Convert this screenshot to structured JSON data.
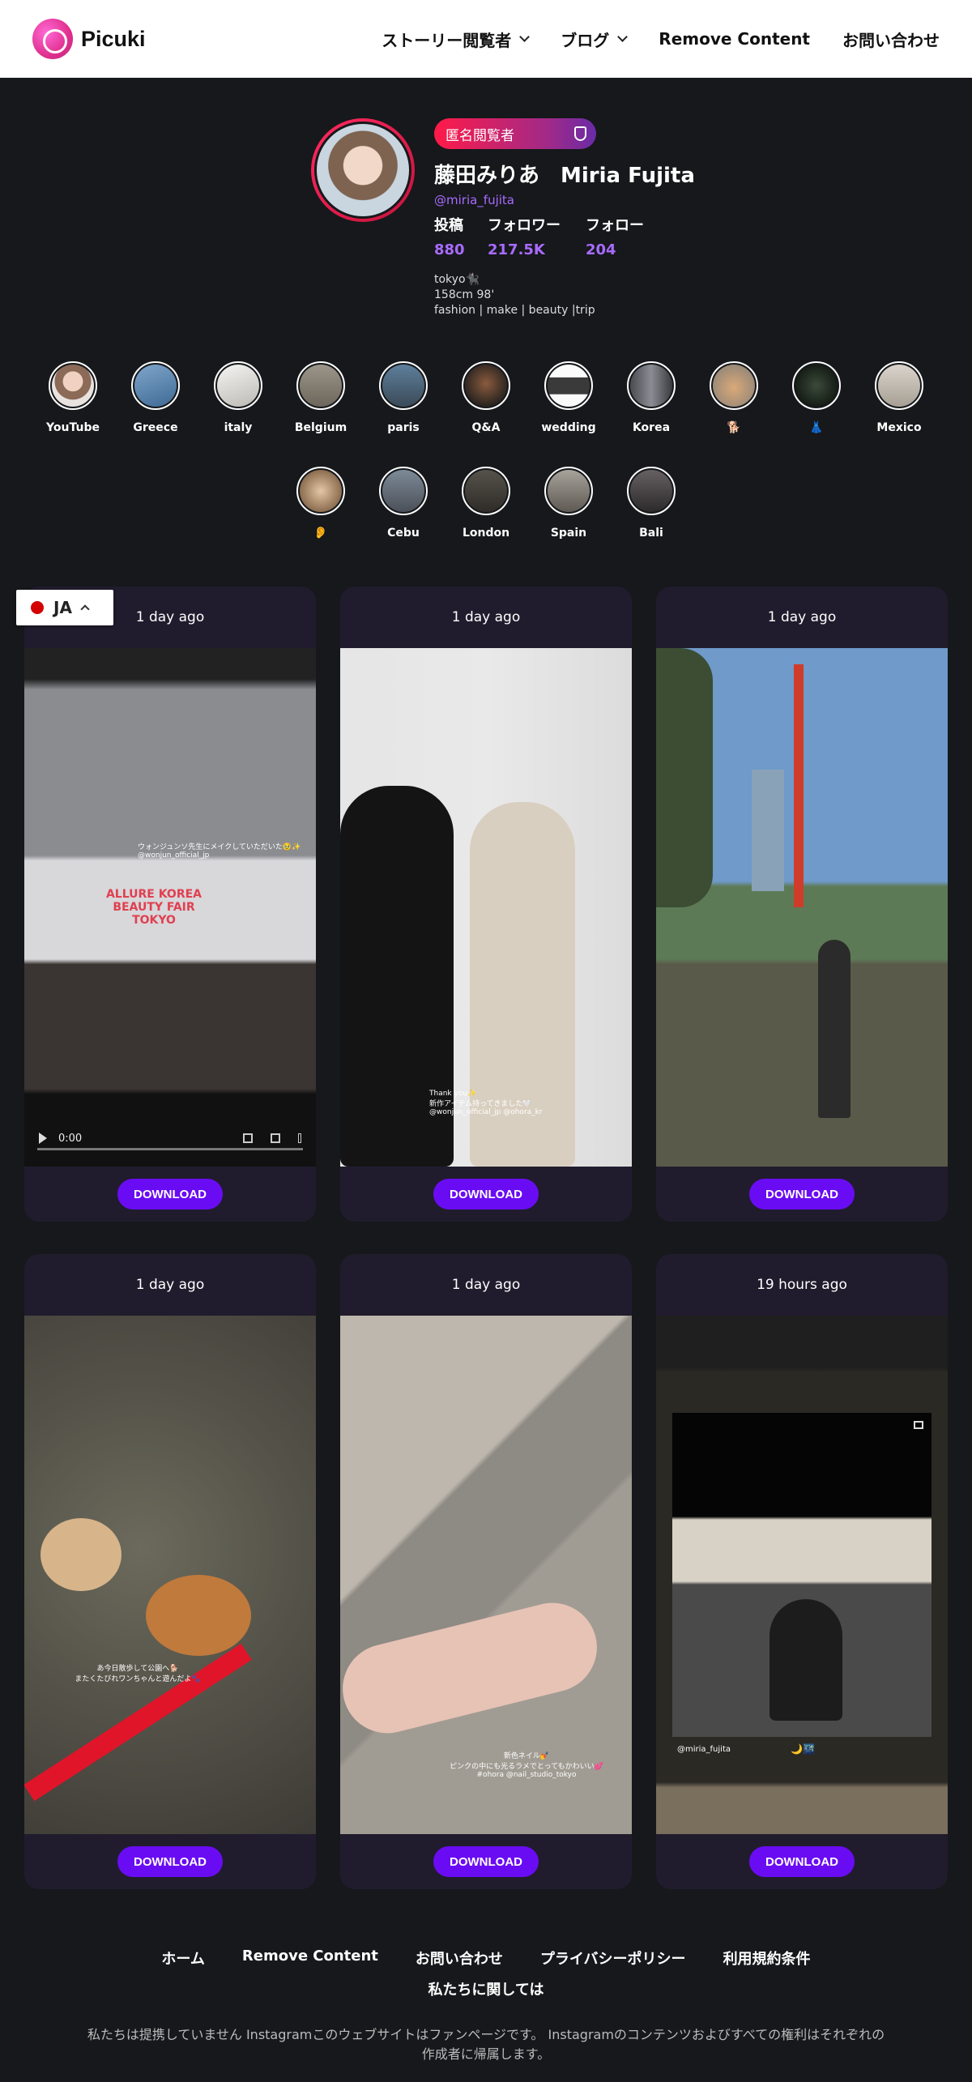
{
  "header": {
    "logo_text": "Picuki",
    "nav": [
      {
        "label": "ストーリー閲覧者",
        "dropdown": true
      },
      {
        "label": "ブログ",
        "dropdown": true
      },
      {
        "label": "Remove Content",
        "dropdown": false
      },
      {
        "label": "お問い合わせ",
        "dropdown": false
      }
    ]
  },
  "profile": {
    "badge": "匿名閲覧者",
    "name": "藤田みりあ　Miria Fujita",
    "handle": "@miria_fujita",
    "stats": [
      {
        "label": "投稿",
        "value": "880"
      },
      {
        "label": "フォロワー",
        "value": "217.5K"
      },
      {
        "label": "フォロー",
        "value": "204"
      }
    ],
    "bio": [
      "tokyo🐈‍⬛",
      "158cm 98'",
      "fashion | make | beauty |trip"
    ]
  },
  "highlights": [
    {
      "label": "YouTube"
    },
    {
      "label": "Greece"
    },
    {
      "label": "italy"
    },
    {
      "label": "Belgium"
    },
    {
      "label": "paris"
    },
    {
      "label": "Q&A"
    },
    {
      "label": "wedding"
    },
    {
      "label": "Korea"
    },
    {
      "label": "🐕"
    },
    {
      "label": "👗"
    },
    {
      "label": "Mexico"
    },
    {
      "label": "👂"
    },
    {
      "label": "Cebu"
    },
    {
      "label": "London"
    },
    {
      "label": "Spain"
    },
    {
      "label": "Bali"
    }
  ],
  "posts": [
    {
      "time": "1 day ago",
      "download": "DOWNLOAD",
      "video_time": "0:00",
      "overlay": "ウォンジュンソ先生にメイクしていただいた🥹✨\n@wonjun_official_jp",
      "sign": "ALLURE KOREA\nBEAUTY FAIR\nTOKYO"
    },
    {
      "time": "1 day ago",
      "download": "DOWNLOAD",
      "overlay": "Thank you✨\n新作アイテム持ってきました🤍\n@wonjun_official_jp @ohora_kr"
    },
    {
      "time": "1 day ago",
      "download": "DOWNLOAD"
    },
    {
      "time": "1 day ago",
      "download": "DOWNLOAD",
      "overlay": "あ今日散歩して公園へ🐕\nまたくたびれワンちゃんと遊んだよ🐾"
    },
    {
      "time": "1 day ago",
      "download": "DOWNLOAD",
      "overlay": "新色ネイル💅\nピンクの中にも光るラメでとってもかわいい💕\n#ohora @nail_studio_tokyo"
    },
    {
      "time": "19 hours ago",
      "download": "DOWNLOAD",
      "caption": "@miria_fujita",
      "caption_emoji": "🌙🌃"
    }
  ],
  "lang": {
    "code": "JA"
  },
  "footer": {
    "links": [
      "ホーム",
      "Remove Content",
      "お問い合わせ",
      "プライバシーポリシー",
      "利用規約条件"
    ],
    "second": "私たちに関しては",
    "note": "私たちは提携していません Instagramこのウェブサイトはファンページです。 Instagramのコンテンツおよびすべての権利はそれぞれの作成者に帰属します。"
  },
  "colors": {
    "accent": "#6a0cf3",
    "link": "#a86bff",
    "background": "#16181b",
    "card": "#201c2d"
  }
}
